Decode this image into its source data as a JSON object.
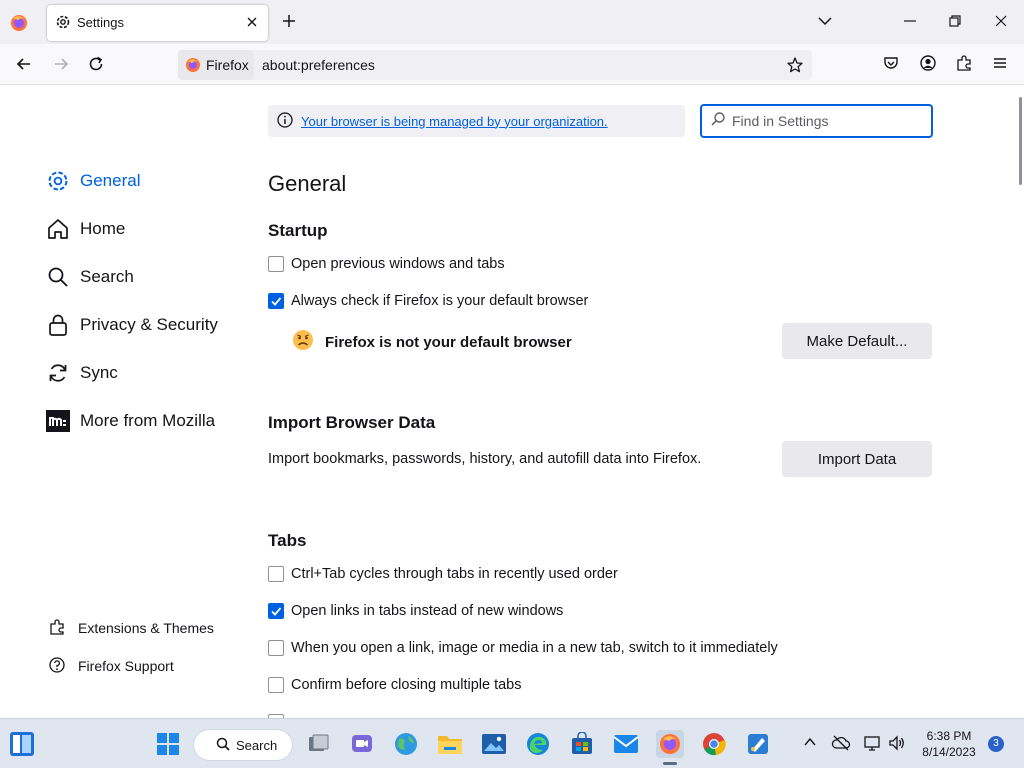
{
  "tab": {
    "title": "Settings"
  },
  "urlbar": {
    "identity_label": "Firefox",
    "url": "about:preferences"
  },
  "managed_notice": "Your browser is being managed by your organization.",
  "find": {
    "placeholder": "Find in Settings"
  },
  "sidebar": {
    "items": [
      {
        "label": "General",
        "icon": "gear-icon"
      },
      {
        "label": "Home",
        "icon": "home-icon"
      },
      {
        "label": "Search",
        "icon": "search-icon"
      },
      {
        "label": "Privacy & Security",
        "icon": "lock-icon"
      },
      {
        "label": "Sync",
        "icon": "sync-icon"
      },
      {
        "label": "More from Mozilla",
        "icon": "mozilla-icon"
      }
    ],
    "footer": [
      {
        "label": "Extensions & Themes",
        "icon": "puzzle-icon"
      },
      {
        "label": "Firefox Support",
        "icon": "help-icon"
      }
    ]
  },
  "main": {
    "title": "General",
    "startup": {
      "heading": "Startup",
      "open_previous": "Open previous windows and tabs",
      "always_check": "Always check if Firefox is your default browser",
      "not_default": "Firefox is not your default browser",
      "make_default": "Make Default..."
    },
    "import": {
      "heading": "Import Browser Data",
      "description": "Import bookmarks, passwords, history, and autofill data into Firefox.",
      "button": "Import Data"
    },
    "tabs": {
      "heading": "Tabs",
      "ctrl_tab": "Ctrl+Tab cycles through tabs in recently used order",
      "open_links": "Open links in tabs instead of new windows",
      "switch_to": "When you open a link, image or media in a new tab, switch to it immediately",
      "confirm_close": "Confirm before closing multiple tabs"
    }
  },
  "taskbar": {
    "search_label": "Search",
    "time": "6:38 PM",
    "date": "8/14/2023",
    "badge": "3"
  },
  "colors": {
    "accent": "#0061e0",
    "checked": "#0061e0"
  }
}
